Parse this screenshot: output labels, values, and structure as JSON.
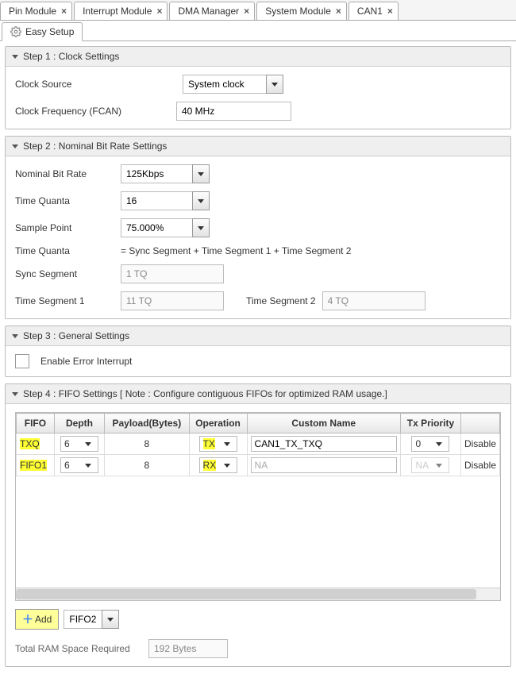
{
  "tabs": [
    {
      "label": "Pin Module"
    },
    {
      "label": "Interrupt Module"
    },
    {
      "label": "DMA Manager"
    },
    {
      "label": "System Module"
    },
    {
      "label": "CAN1"
    }
  ],
  "subtab": {
    "label": "Easy Setup"
  },
  "step1": {
    "title": "Step 1 : Clock Settings",
    "clock_source_label": "Clock Source",
    "clock_source_value": "System clock",
    "clock_freq_label": "Clock Frequency (FCAN)",
    "clock_freq_value": "40 MHz"
  },
  "step2": {
    "title": "Step 2 : Nominal Bit Rate Settings",
    "nbr_label": "Nominal Bit Rate",
    "nbr_value": "125Kbps",
    "tq_label": "Time Quanta",
    "tq_value": "16",
    "sp_label": "Sample Point",
    "sp_value": "75.000%",
    "tq_formula_label": "Time Quanta",
    "tq_formula": "=   Sync Segment + Time Segment 1   + Time Segment 2",
    "sync_label": "Sync Segment",
    "sync_value": "1 TQ",
    "ts1_label": "Time Segment 1",
    "ts1_value": "11 TQ",
    "ts2_label": "Time Segment 2",
    "ts2_value": "4 TQ"
  },
  "step3": {
    "title": "Step 3 : General Settings",
    "err_int_label": "Enable Error Interrupt"
  },
  "step4": {
    "title": "Step 4 : FIFO Settings [ Note : Configure contiguous FIFOs for optimized RAM usage.]",
    "columns": [
      "FIFO",
      "Depth",
      "Payload(Bytes)",
      "Operation",
      "Custom Name",
      "Tx Priority",
      ""
    ],
    "rows": [
      {
        "fifo": "TXQ",
        "depth": "6",
        "payload": "8",
        "operation": "TX",
        "custom_name": "CAN1_TX_TXQ",
        "tx_priority": "0",
        "extra": "Disable"
      },
      {
        "fifo": "FIFO1",
        "depth": "6",
        "payload": "8",
        "operation": "RX",
        "custom_name": "NA",
        "tx_priority": "NA",
        "extra": "Disable"
      }
    ],
    "add_label": "Add",
    "add_fifo": "FIFO2",
    "ram_label": "Total RAM Space Required",
    "ram_value": "192 Bytes"
  }
}
